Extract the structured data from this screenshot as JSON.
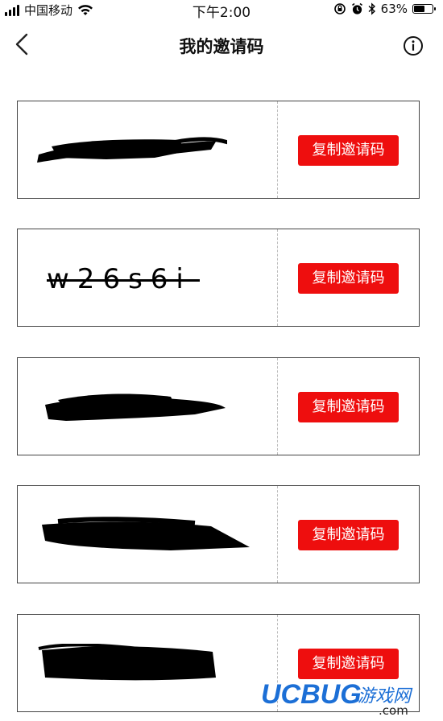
{
  "status_bar": {
    "carrier": "中国移动",
    "time": "下午2:00",
    "battery": "63%",
    "battery_level": 0.63,
    "icons": [
      "signal-icon",
      "wifi-icon",
      "orientation-lock-icon",
      "alarm-icon",
      "bluetooth-icon",
      "battery-icon"
    ]
  },
  "nav": {
    "title": "我的邀请码",
    "back_icon": "back-arrow-icon",
    "info_icon": "info-icon"
  },
  "cards": [
    {
      "code": "",
      "redacted": true,
      "button": "复制邀请码"
    },
    {
      "code": "w26s6i",
      "redacted": false,
      "button": "复制邀请码"
    },
    {
      "code": "",
      "redacted": true,
      "button": "复制邀请码"
    },
    {
      "code": "",
      "redacted": true,
      "button": "复制邀请码"
    },
    {
      "code": "",
      "redacted": true,
      "button": "复制邀请码"
    }
  ],
  "watermark": {
    "brand": "UCBUG",
    "suffix": "游戏网",
    "domain": ".com"
  },
  "colors": {
    "accent": "#ee0e0e",
    "watermark_blue": "#1c6fd6",
    "watermark_orange": "#f58a1f"
  }
}
